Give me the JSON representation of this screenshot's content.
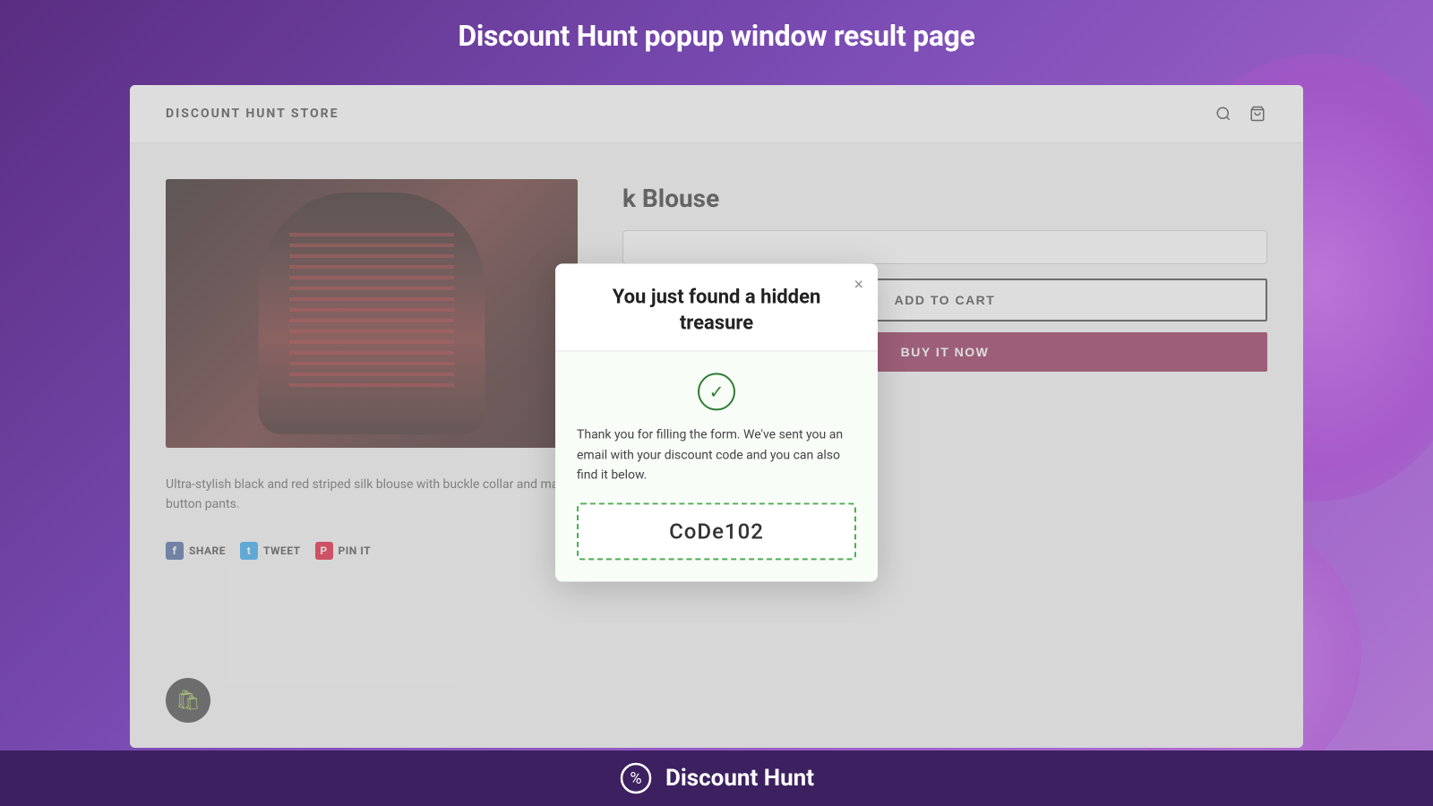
{
  "page": {
    "title": "Discount Hunt popup window result page"
  },
  "store": {
    "logo": "DISCOUNT HUNT STORE",
    "product": {
      "name": "k Blouse",
      "description": "Ultra-stylish black and red striped silk blouse with buckle collar and matching button pants.",
      "size_placeholder": "",
      "add_to_cart": "ADD TO CART",
      "buy_now": "BUY IT NOW"
    },
    "social": {
      "share": "SHARE",
      "tweet": "TWEET",
      "pin": "PIN IT"
    }
  },
  "modal": {
    "title": "You just found a hidden treasure",
    "close_label": "×",
    "success_message": "Thank you for filling the form. We've sent you an email with your discount code and you can also find it below.",
    "discount_code": "CoDe102"
  },
  "footer": {
    "brand": "Discount Hunt",
    "icon": "🏷️"
  }
}
